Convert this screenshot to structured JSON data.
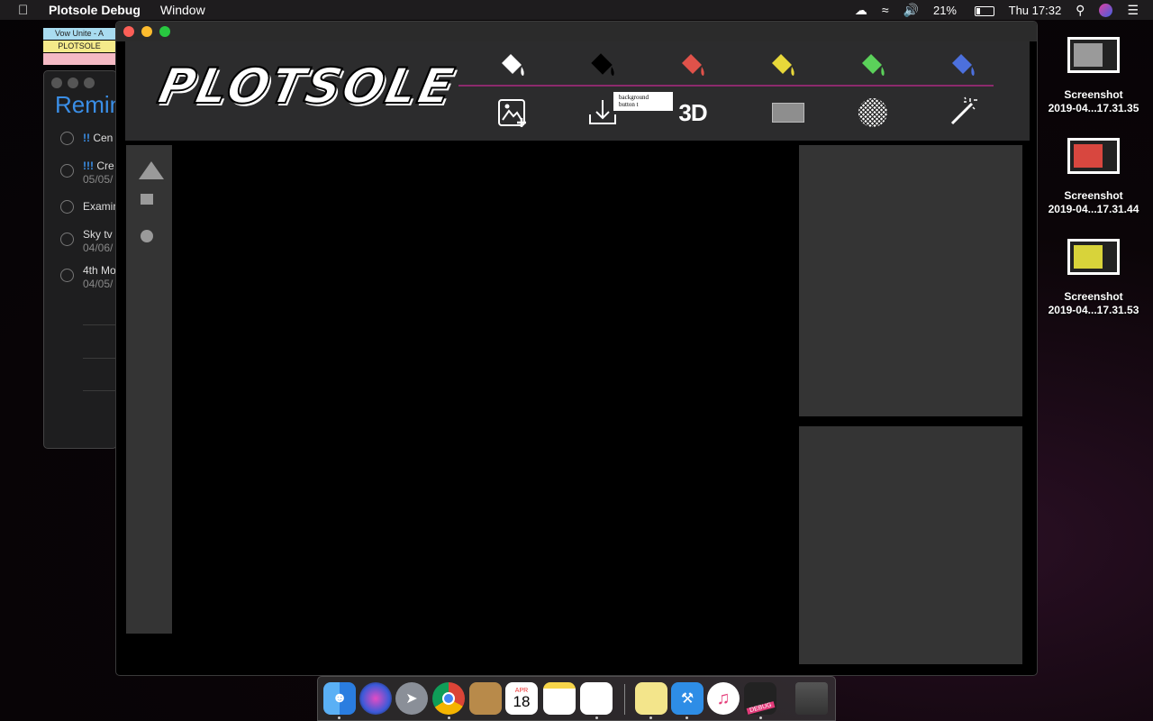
{
  "menubar": {
    "apple_icon": "apple-icon",
    "app_name": "Plotsole Debug",
    "menus": [
      "Window"
    ],
    "battery_percent": "21%",
    "clock": "Thu 17:32"
  },
  "stickies": [
    {
      "text": "Vow Unite - A",
      "color": "#a9dcf0"
    },
    {
      "text": "PLOTSOLE",
      "color": "#f5ea8a"
    },
    {
      "text": "",
      "color": "#f4b9c4"
    }
  ],
  "reminders": {
    "title": "Remin",
    "items": [
      {
        "prefix": "!!",
        "text": " Cen",
        "date": ""
      },
      {
        "prefix": "!!!",
        "text": " Cre",
        "date": "05/05/"
      },
      {
        "prefix": "",
        "text": "Examin",
        "date": ""
      },
      {
        "prefix": "",
        "text": "Sky tv",
        "date": "04/06/"
      },
      {
        "prefix": "",
        "text": "4th Mo",
        "date": "04/05/"
      }
    ]
  },
  "plotsole": {
    "logo": "PLOTSOLE",
    "fill_colors": [
      "#ffffff",
      "#000000",
      "#e0524a",
      "#e8d83a",
      "#5bd15a",
      "#4c70dd"
    ],
    "tooltip": {
      "line1": "background",
      "line2": "button t"
    },
    "three_d_label": "3D"
  },
  "desktop_files": [
    {
      "line1": "Screenshot",
      "line2": "2019-04...17.31.35",
      "thumb_color": "#9a9a9a"
    },
    {
      "line1": "Screenshot",
      "line2": "2019-04...17.31.44",
      "thumb_color": "#d8473f"
    },
    {
      "line1": "Screenshot",
      "line2": "2019-04...17.31.53",
      "thumb_color": "#d8d33a"
    }
  ],
  "calendar": {
    "month": "APR",
    "day": "18"
  },
  "debug_badge": "DEBUG"
}
